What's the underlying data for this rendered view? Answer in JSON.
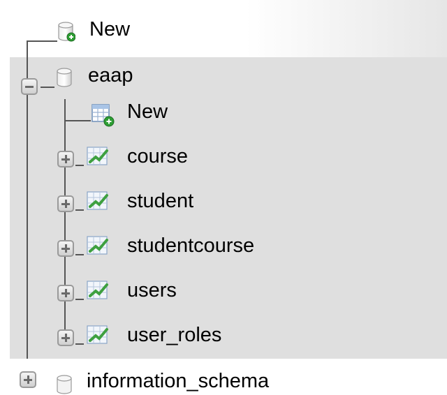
{
  "navigation_tree": {
    "new_database_label": "New",
    "databases": [
      {
        "name": "eaap",
        "expanded": true,
        "new_table_label": "New",
        "tables": [
          {
            "name": "course"
          },
          {
            "name": "student"
          },
          {
            "name": "studentcourse"
          },
          {
            "name": "users"
          },
          {
            "name": "user_roles"
          }
        ]
      },
      {
        "name": "information_schema",
        "expanded": false
      }
    ]
  },
  "colors": {
    "selected_background": "#dfdfdf",
    "tree_line": "#555555",
    "table_icon_green": "#3ea040",
    "add_badge_green": "#2e9e34"
  }
}
